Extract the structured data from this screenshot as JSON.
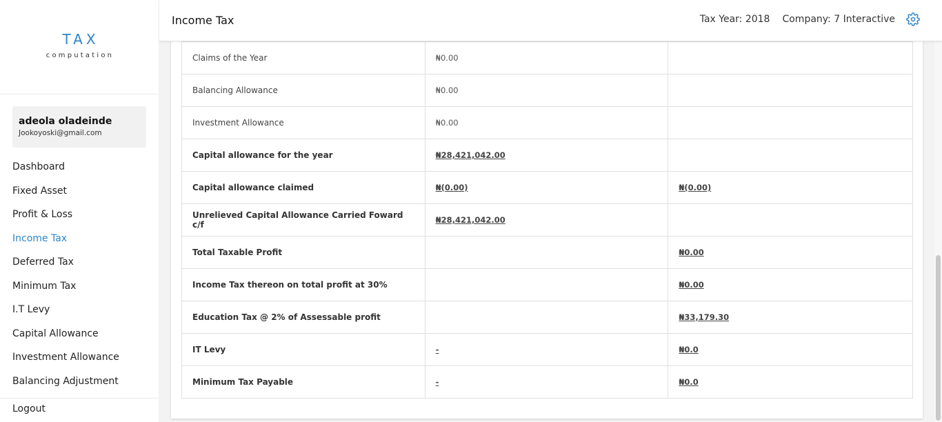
{
  "logo": {
    "title": "TAX",
    "subtitle": "computation"
  },
  "user": {
    "name": "adeola oladeinde",
    "email": "Jookoyoski@gmail.com"
  },
  "nav": {
    "items": [
      {
        "label": "Dashboard"
      },
      {
        "label": "Fixed Asset"
      },
      {
        "label": "Profit & Loss"
      },
      {
        "label": "Income Tax",
        "active": true
      },
      {
        "label": "Deferred Tax"
      },
      {
        "label": "Minimum Tax"
      },
      {
        "label": "I.T Levy"
      },
      {
        "label": "Capital Allowance"
      },
      {
        "label": "Investment Allowance"
      },
      {
        "label": "Balancing Adjustment"
      }
    ],
    "logout": "Logout"
  },
  "header": {
    "title": "Income Tax",
    "tax_year": "Tax Year: 2018",
    "company": "Company: 7 Interactive",
    "settings_icon": "gear-icon",
    "accent": "#2e86c8"
  },
  "table": {
    "rows": [
      {
        "label": "Claims of the Year",
        "col2": "₦0.00",
        "col3": ""
      },
      {
        "label": "Balancing Allowance",
        "col2": "₦0.00",
        "col3": ""
      },
      {
        "label": "Investment Allowance",
        "col2": "₦0.00",
        "col3": ""
      },
      {
        "label": "Capital allowance for the year",
        "col2": "₦28,421,042.00",
        "col3": ""
      },
      {
        "label": "Capital allowance claimed",
        "col2": "₦(0.00)",
        "col3": "₦(0.00)"
      },
      {
        "label": "Unrelieved Capital Allowance Carried Foward c/f",
        "col2": "₦28,421,042.00",
        "col3": ""
      },
      {
        "label": "Total Taxable Profit",
        "col2": "",
        "col3": "₦0.00"
      },
      {
        "label": "Income Tax thereon on total profit at 30%",
        "col2": "",
        "col3": "₦0.00"
      },
      {
        "label": "Education Tax @ 2% of Assessable profit",
        "col2": "",
        "col3": "₦33,179.30"
      },
      {
        "label": "IT Levy",
        "col2": "-",
        "col3": "₦0.0"
      },
      {
        "label": "Minimum Tax Payable",
        "col2": "-",
        "col3": "₦0.0"
      }
    ]
  }
}
